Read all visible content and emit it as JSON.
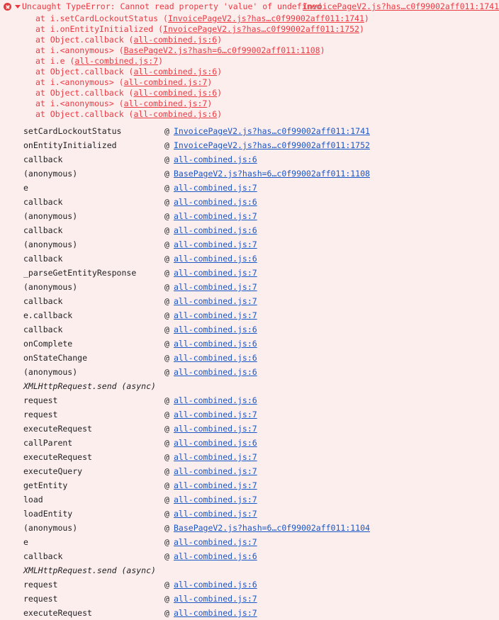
{
  "console": {
    "error": {
      "icon": "error-circle-icon",
      "expanded": true,
      "disclosure_icon": "triangle-down-icon",
      "message": "Uncaught TypeError: Cannot read property 'value' of undefined",
      "source_link": "InvoicePageV2.js?has…c0f99002aff011:1741",
      "frames": [
        {
          "prefix": "at ",
          "fn": "i.setCardLockoutStatus",
          "open": " (",
          "link": "InvoicePageV2.js?has…c0f99002aff011:1741",
          "close": ")"
        },
        {
          "prefix": "at ",
          "fn": "i.onEntityInitialized",
          "open": " (",
          "link": "InvoicePageV2.js?has…c0f99002aff011:1752",
          "close": ")"
        },
        {
          "prefix": "at ",
          "fn": "Object.callback",
          "open": " (",
          "link": "all-combined.js:6",
          "close": ")"
        },
        {
          "prefix": "at ",
          "fn": "i.<anonymous>",
          "open": " (",
          "link": "BasePageV2.js?hash=6…c0f99002aff011:1108",
          "close": ")"
        },
        {
          "prefix": "at ",
          "fn": "i.e",
          "open": " (",
          "link": "all-combined.js:7",
          "close": ")"
        },
        {
          "prefix": "at ",
          "fn": "Object.callback",
          "open": " (",
          "link": "all-combined.js:6",
          "close": ")"
        },
        {
          "prefix": "at ",
          "fn": "i.<anonymous>",
          "open": " (",
          "link": "all-combined.js:7",
          "close": ")"
        },
        {
          "prefix": "at ",
          "fn": "Object.callback",
          "open": " (",
          "link": "all-combined.js:6",
          "close": ")"
        },
        {
          "prefix": "at ",
          "fn": "i.<anonymous>",
          "open": " (",
          "link": "all-combined.js:7",
          "close": ")"
        },
        {
          "prefix": "at ",
          "fn": "Object.callback",
          "open": " (",
          "link": "all-combined.js:6",
          "close": ")"
        }
      ]
    },
    "stack_trace": {
      "at_symbol": "@",
      "rows": [
        {
          "fn": "setCardLockoutStatus",
          "link": "InvoicePageV2.js?has…c0f99002aff011:1741",
          "async": false
        },
        {
          "fn": "onEntityInitialized",
          "link": "InvoicePageV2.js?has…c0f99002aff011:1752",
          "async": false
        },
        {
          "fn": "callback",
          "link": "all-combined.js:6",
          "async": false
        },
        {
          "fn": "(anonymous)",
          "link": "BasePageV2.js?hash=6…c0f99002aff011:1108",
          "async": false
        },
        {
          "fn": "e",
          "link": "all-combined.js:7",
          "async": false
        },
        {
          "fn": "callback",
          "link": "all-combined.js:6",
          "async": false
        },
        {
          "fn": "(anonymous)",
          "link": "all-combined.js:7",
          "async": false
        },
        {
          "fn": "callback",
          "link": "all-combined.js:6",
          "async": false
        },
        {
          "fn": "(anonymous)",
          "link": "all-combined.js:7",
          "async": false
        },
        {
          "fn": "callback",
          "link": "all-combined.js:6",
          "async": false
        },
        {
          "fn": "_parseGetEntityResponse",
          "link": "all-combined.js:7",
          "async": false
        },
        {
          "fn": "(anonymous)",
          "link": "all-combined.js:7",
          "async": false
        },
        {
          "fn": "callback",
          "link": "all-combined.js:7",
          "async": false
        },
        {
          "fn": "e.callback",
          "link": "all-combined.js:7",
          "async": false
        },
        {
          "fn": "callback",
          "link": "all-combined.js:6",
          "async": false
        },
        {
          "fn": "onComplete",
          "link": "all-combined.js:6",
          "async": false
        },
        {
          "fn": "onStateChange",
          "link": "all-combined.js:6",
          "async": false
        },
        {
          "fn": "(anonymous)",
          "link": "all-combined.js:6",
          "async": false
        },
        {
          "fn": "XMLHttpRequest.send (async)",
          "link": "",
          "async": true
        },
        {
          "fn": "request",
          "link": "all-combined.js:6",
          "async": false
        },
        {
          "fn": "request",
          "link": "all-combined.js:7",
          "async": false
        },
        {
          "fn": "executeRequest",
          "link": "all-combined.js:7",
          "async": false
        },
        {
          "fn": "callParent",
          "link": "all-combined.js:6",
          "async": false
        },
        {
          "fn": "executeRequest",
          "link": "all-combined.js:7",
          "async": false
        },
        {
          "fn": "executeQuery",
          "link": "all-combined.js:7",
          "async": false
        },
        {
          "fn": "getEntity",
          "link": "all-combined.js:7",
          "async": false
        },
        {
          "fn": "load",
          "link": "all-combined.js:7",
          "async": false
        },
        {
          "fn": "loadEntity",
          "link": "all-combined.js:7",
          "async": false
        },
        {
          "fn": "(anonymous)",
          "link": "BasePageV2.js?hash=6…c0f99002aff011:1104",
          "async": false
        },
        {
          "fn": "e",
          "link": "all-combined.js:7",
          "async": false
        },
        {
          "fn": "callback",
          "link": "all-combined.js:6",
          "async": false
        },
        {
          "fn": "XMLHttpRequest.send (async)",
          "link": "",
          "async": true
        },
        {
          "fn": "request",
          "link": "all-combined.js:6",
          "async": false
        },
        {
          "fn": "request",
          "link": "all-combined.js:7",
          "async": false
        },
        {
          "fn": "executeRequest",
          "link": "all-combined.js:7",
          "async": false
        }
      ]
    }
  },
  "colors": {
    "background": "#fdeeee",
    "error_text": "#eb3941",
    "error_icon": "#e23c3c",
    "link": "#1a56c4",
    "text": "#202124"
  }
}
